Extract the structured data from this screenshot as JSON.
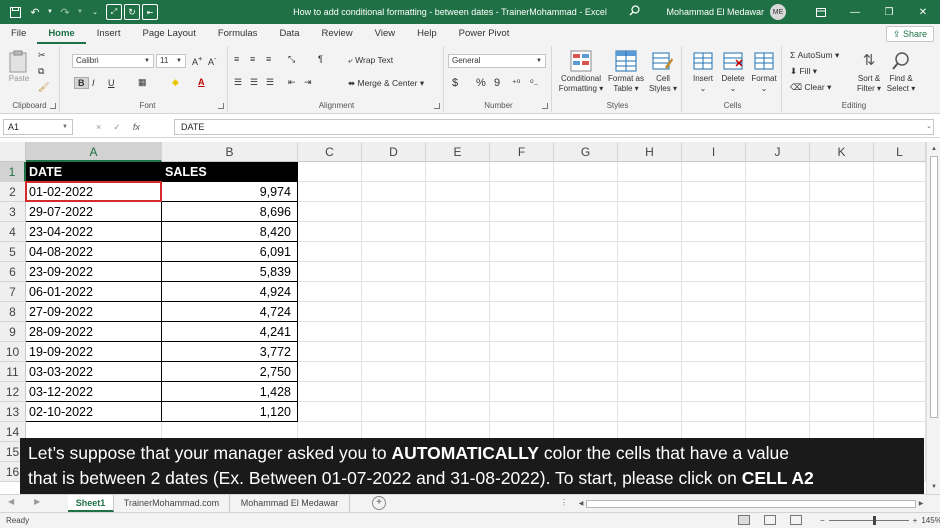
{
  "title_bar": {
    "doc_title": "How to add conditional formatting - between dates - TrainerMohammad  -  Excel",
    "user_name": "Mohammad El Medawar",
    "avatar_initials": "ME"
  },
  "ribbon_tabs": [
    "File",
    "Home",
    "Insert",
    "Page Layout",
    "Formulas",
    "Data",
    "Review",
    "View",
    "Help",
    "Power Pivot"
  ],
  "active_tab": "Home",
  "share_label": "Share",
  "ribbon": {
    "clipboard": {
      "paste_label": "Paste",
      "group_label": "Clipboard"
    },
    "font": {
      "font_name": "Calibri",
      "font_size": "11",
      "group_label": "Font",
      "bold": "B",
      "italic": "I",
      "underline": "U"
    },
    "alignment": {
      "wrap_text": "Wrap Text",
      "merge_center": "Merge & Center",
      "group_label": "Alignment"
    },
    "number": {
      "format": "General",
      "currency": "$",
      "percent": "%",
      "comma": "9",
      "group_label": "Number"
    },
    "styles": {
      "conditional_formatting": [
        "Conditional",
        "Formatting"
      ],
      "format_as_table": [
        "Format as",
        "Table"
      ],
      "cell_styles": [
        "Cell",
        "Styles"
      ],
      "group_label": "Styles"
    },
    "cells": {
      "insert": "Insert",
      "delete": "Delete",
      "format": "Format",
      "group_label": "Cells"
    },
    "editing": {
      "autosum": "AutoSum",
      "fill": "Fill",
      "clear": "Clear",
      "sort_filter": [
        "Sort &",
        "Filter"
      ],
      "find_select": [
        "Find &",
        "Select"
      ],
      "group_label": "Editing"
    }
  },
  "formula_bar": {
    "name_box": "A1",
    "formula": "DATE",
    "cancel_icon": "×",
    "enter_icon": "✓",
    "fx_icon": "fx"
  },
  "columns": [
    "A",
    "B",
    "C",
    "D",
    "E",
    "F",
    "G",
    "H",
    "I",
    "J",
    "K",
    "L"
  ],
  "rows": [
    "1",
    "2",
    "3",
    "4",
    "5",
    "6",
    "7",
    "8",
    "9",
    "10",
    "11",
    "12",
    "13",
    "14",
    "15",
    "16"
  ],
  "table": {
    "headers": [
      "DATE",
      "SALES"
    ],
    "rows": [
      [
        "01-02-2022",
        "9,974"
      ],
      [
        "29-07-2022",
        "8,696"
      ],
      [
        "23-04-2022",
        "8,420"
      ],
      [
        "04-08-2022",
        "6,091"
      ],
      [
        "23-09-2022",
        "5,839"
      ],
      [
        "06-01-2022",
        "4,924"
      ],
      [
        "27-09-2022",
        "4,724"
      ],
      [
        "28-09-2022",
        "4,241"
      ],
      [
        "19-09-2022",
        "3,772"
      ],
      [
        "03-03-2022",
        "2,750"
      ],
      [
        "03-12-2022",
        "1,428"
      ],
      [
        "02-10-2022",
        "1,120"
      ]
    ]
  },
  "caption": {
    "line1_a": "Let’s suppose that your manager asked you to ",
    "line1_b": "AUTOMATICALLY",
    "line1_c": " color the cells that have a value",
    "line2_a": "that is between 2 dates (Ex. Between 01-07-2022 and 31-08-2022). To start, please click on ",
    "line2_b": "CELL A2"
  },
  "sheets": [
    "Sheet1",
    "TrainerMohammad.com",
    "Mohammad El Medawar"
  ],
  "active_sheet": "Sheet1",
  "status": {
    "ready": "Ready",
    "zoom": "145%"
  },
  "colors": {
    "excel_green": "#1f7145",
    "selection_red": "#d42a2a",
    "header_black": "#000000"
  }
}
